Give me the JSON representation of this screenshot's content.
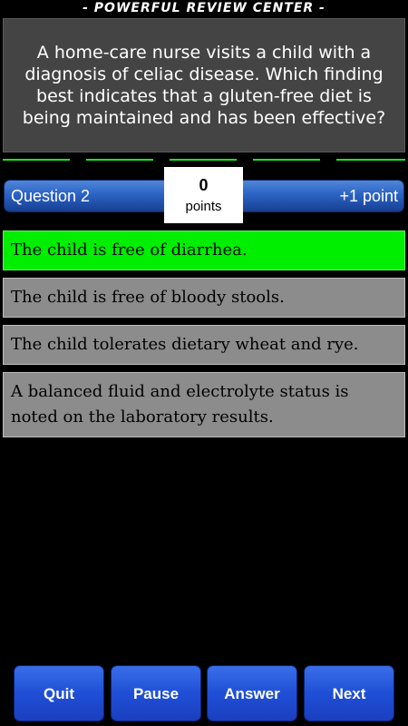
{
  "app": {
    "title": "- POWERFUL REVIEW CENTER -"
  },
  "question": {
    "text": "A home-care nurse visits a child with a diagnosis of celiac disease. Which finding best indicates that a gluten-free diet is being maintained and has been effective?"
  },
  "status": {
    "question_label": "Question 2",
    "point_value": "+1 point",
    "score": "0",
    "score_unit": "points"
  },
  "answers": [
    {
      "text": "The child is free of diarrhea.",
      "state": "correct"
    },
    {
      "text": "The child is free of bloody stools.",
      "state": "default"
    },
    {
      "text": "The child tolerates dietary wheat and rye.",
      "state": "default"
    },
    {
      "text": "A balanced fluid and electrolyte status is noted on the laboratory results.",
      "state": "default"
    }
  ],
  "buttons": {
    "quit": "Quit",
    "pause": "Pause",
    "answer": "Answer",
    "next": "Next"
  },
  "colors": {
    "correct_answer": "#00ee00",
    "default_answer": "#8c8c8c",
    "divider": "#19e619",
    "button_blue": "#1f4fd6",
    "question_bg": "#444444"
  }
}
